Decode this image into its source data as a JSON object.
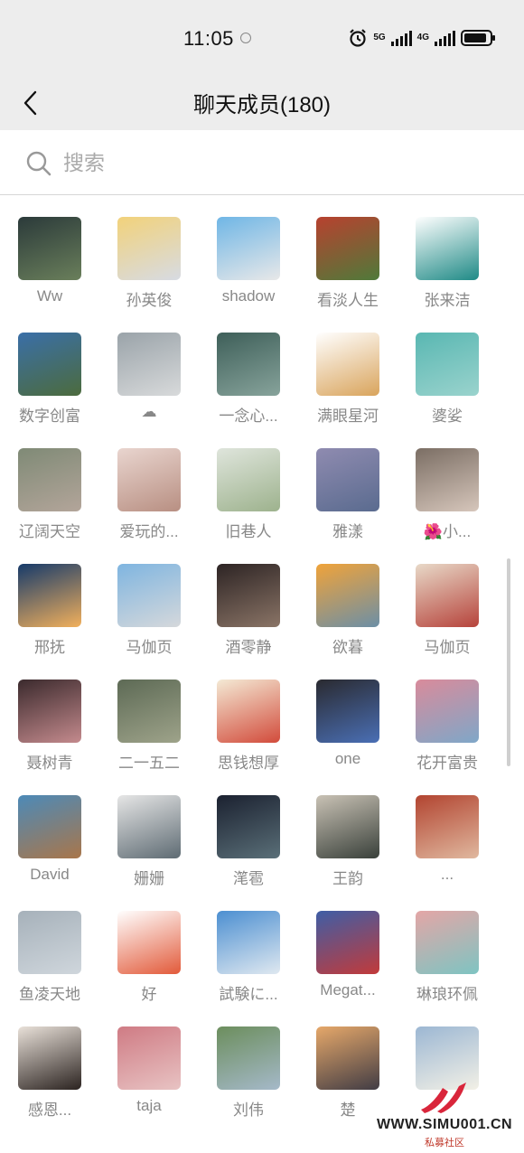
{
  "status_bar": {
    "time": "11:05",
    "network_1": "5G",
    "network_2": "4G"
  },
  "header": {
    "title": "聊天成员(180)",
    "back_icon": "chevron-left-icon"
  },
  "search": {
    "placeholder": "搜索",
    "value": "",
    "icon": "search-icon"
  },
  "members": [
    {
      "name": "Ww",
      "colors": [
        "#2b3a3a",
        "#6a7f5b"
      ]
    },
    {
      "name": "孙英俊",
      "colors": [
        "#f2d27a",
        "#d7dbe3"
      ]
    },
    {
      "name": "shadow",
      "colors": [
        "#6fb6e6",
        "#e8e8e8"
      ]
    },
    {
      "name": "看淡人生",
      "colors": [
        "#b8412f",
        "#4f7a3a"
      ]
    },
    {
      "name": "张来洁",
      "colors": [
        "#ffffff",
        "#1f8a86"
      ]
    },
    {
      "name": "数字创富",
      "colors": [
        "#3a6fa8",
        "#4c6b3d"
      ]
    },
    {
      "name": "☁",
      "colors": [
        "#9aa3a9",
        "#d8dadb"
      ]
    },
    {
      "name": "一念心...",
      "colors": [
        "#3e5f59",
        "#87a39b"
      ]
    },
    {
      "name": "满眼星河",
      "colors": [
        "#ffffff",
        "#d9a45c"
      ]
    },
    {
      "name": "婆娑",
      "colors": [
        "#59b7b2",
        "#9ad3cd"
      ]
    },
    {
      "name": "辽阔天空",
      "colors": [
        "#7f8a76",
        "#b3a59a"
      ]
    },
    {
      "name": "爱玩的...",
      "colors": [
        "#e9d5cf",
        "#b88f82"
      ]
    },
    {
      "name": "旧巷人",
      "colors": [
        "#dfe5dc",
        "#9db28d"
      ]
    },
    {
      "name": "雅漾",
      "colors": [
        "#8f8bb0",
        "#5a6b8f"
      ]
    },
    {
      "name": "🌺小...",
      "colors": [
        "#7b6e64",
        "#d6c6bb"
      ]
    },
    {
      "name": "邢抚",
      "colors": [
        "#163a6a",
        "#f2b05c"
      ]
    },
    {
      "name": "马伽页",
      "colors": [
        "#7fb5e0",
        "#d5d8db"
      ]
    },
    {
      "name": "酒零静",
      "colors": [
        "#2d2424",
        "#8a7466"
      ]
    },
    {
      "name": "欲暮",
      "colors": [
        "#f0a33a",
        "#6c8fa6"
      ]
    },
    {
      "name": "马伽页",
      "colors": [
        "#e8d9c8",
        "#b6433b"
      ]
    },
    {
      "name": "聂树青",
      "colors": [
        "#3b2a2d",
        "#c48a8d"
      ]
    },
    {
      "name": "二一五二",
      "colors": [
        "#5d6a55",
        "#9ea38a"
      ]
    },
    {
      "name": "思钱想厚",
      "colors": [
        "#f4ead5",
        "#d24b3b"
      ]
    },
    {
      "name": "one",
      "colors": [
        "#2a2a30",
        "#4a6fb5"
      ]
    },
    {
      "name": "花开富贵",
      "colors": [
        "#d98b9b",
        "#7fa7c8"
      ]
    },
    {
      "name": "David",
      "colors": [
        "#4c8ab8",
        "#a9764a"
      ]
    },
    {
      "name": "姗姗",
      "colors": [
        "#e6e6e6",
        "#5e6b73"
      ]
    },
    {
      "name": "滗雹",
      "colors": [
        "#1b2130",
        "#5a6f78"
      ]
    },
    {
      "name": "王韵",
      "colors": [
        "#c9c2b5",
        "#39403a"
      ]
    },
    {
      "name": "...",
      "colors": [
        "#b24430",
        "#e0b89f"
      ]
    },
    {
      "name": "鱼凌天地",
      "colors": [
        "#a6b1ba",
        "#cfd6dc"
      ]
    },
    {
      "name": "好",
      "colors": [
        "#ffffff",
        "#e25a3a"
      ]
    },
    {
      "name": "試験に...",
      "colors": [
        "#4c8fd1",
        "#dfe8f0"
      ]
    },
    {
      "name": "Megat...",
      "colors": [
        "#3e5ea6",
        "#c23a3a"
      ]
    },
    {
      "name": "琳琅环佩",
      "colors": [
        "#e4a6a6",
        "#7ec4c2"
      ]
    },
    {
      "name": "感恩...",
      "colors": [
        "#e9e1d9",
        "#2b2320"
      ]
    },
    {
      "name": "taja",
      "colors": [
        "#cf7b84",
        "#e8c3c3"
      ]
    },
    {
      "name": "刘伟",
      "colors": [
        "#6c8e5d",
        "#a5b9c9"
      ]
    },
    {
      "name": "楚",
      "colors": [
        "#e6a86a",
        "#413c44"
      ]
    },
    {
      "name": "",
      "colors": [
        "#9cb7d3",
        "#f2f0e6"
      ]
    }
  ],
  "watermark": {
    "site": "WWW.SIMU001.CN",
    "label": "私募社区"
  }
}
